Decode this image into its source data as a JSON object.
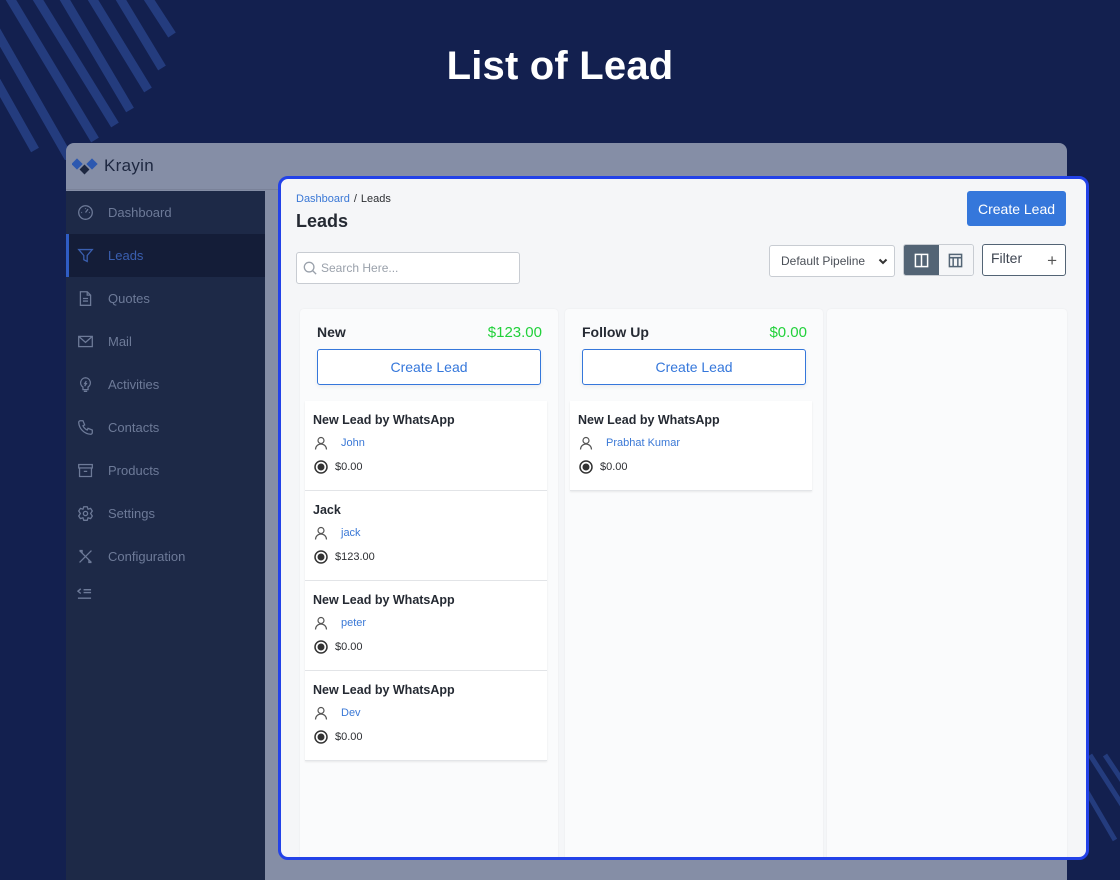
{
  "hero": {
    "title": "List of Lead"
  },
  "app": {
    "brand": "Krayin",
    "sidebar": {
      "items": [
        {
          "label": "Dashboard",
          "icon": "dashboard-gauge-icon",
          "active": false
        },
        {
          "label": "Leads",
          "icon": "funnel-icon",
          "active": true
        },
        {
          "label": "Quotes",
          "icon": "document-icon",
          "active": false
        },
        {
          "label": "Mail",
          "icon": "mail-icon",
          "active": false
        },
        {
          "label": "Activities",
          "icon": "lightbulb-icon",
          "active": false
        },
        {
          "label": "Contacts",
          "icon": "phone-icon",
          "active": false
        },
        {
          "label": "Products",
          "icon": "archive-box-icon",
          "active": false
        },
        {
          "label": "Settings",
          "icon": "gear-icon",
          "active": false
        },
        {
          "label": "Configuration",
          "icon": "tools-icon",
          "active": false
        }
      ],
      "collapse_icon": "collapse-menu-icon"
    }
  },
  "page": {
    "breadcrumb": {
      "parent": "Dashboard",
      "separator": "/",
      "current": "Leads"
    },
    "title": "Leads",
    "create_button": "Create Lead",
    "search": {
      "placeholder": "Search Here...",
      "value": ""
    },
    "pipeline_select": {
      "selected": "Default Pipeline"
    },
    "view_toggle": {
      "active": "kanban",
      "options": [
        "kanban",
        "table"
      ]
    },
    "filter_button": {
      "label": "Filter",
      "icon": "+"
    }
  },
  "columns": [
    {
      "name": "New",
      "total": "$123.00",
      "create_label": "Create Lead",
      "leads": [
        {
          "title": "New Lead by WhatsApp",
          "person": "John",
          "amount": "$0.00"
        },
        {
          "title": "Jack",
          "person": "jack",
          "amount": "$123.00"
        },
        {
          "title": "New Lead by WhatsApp",
          "person": "peter",
          "amount": "$0.00"
        },
        {
          "title": "New Lead by WhatsApp",
          "person": "Dev",
          "amount": "$0.00"
        }
      ]
    },
    {
      "name": "Follow Up",
      "total": "$0.00",
      "create_label": "Create Lead",
      "leads": [
        {
          "title": "New Lead by WhatsApp",
          "person": "Prabhat Kumar",
          "amount": "$0.00"
        }
      ]
    }
  ],
  "colors": {
    "background": "#13204f",
    "highlight_border": "#2342e8",
    "primary": "#3577db",
    "total_green": "#22d13b",
    "sidebar": "#1d2947"
  }
}
